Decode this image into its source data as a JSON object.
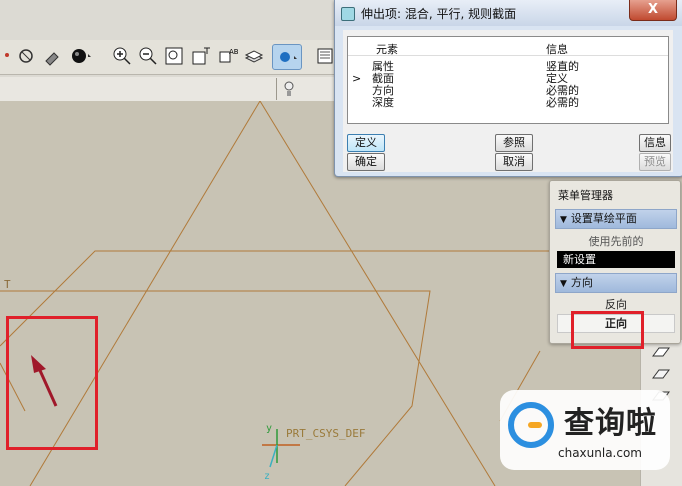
{
  "dialog": {
    "title": "伸出项: 混合, 平行, 规则截面",
    "close_symbol": "X",
    "col_element": "元素",
    "col_info": "信息",
    "current_marker": ">",
    "rows": [
      {
        "element": "属性",
        "info": "竖直的"
      },
      {
        "element": "截面",
        "info": "定义"
      },
      {
        "element": "方向",
        "info": "必需的"
      },
      {
        "element": "深度",
        "info": "必需的"
      }
    ],
    "buttons": {
      "define": "定义",
      "reference": "参照",
      "info": "信息",
      "ok": "确定",
      "cancel": "取消",
      "preview": "预览"
    }
  },
  "menu_manager": {
    "title": "菜单管理器",
    "sections": [
      {
        "header": "设置草绘平面",
        "items": [
          "使用先前的",
          "新设置"
        ]
      },
      {
        "header": "方向",
        "items": [
          "反向",
          "正向"
        ]
      }
    ]
  },
  "graphics": {
    "csys_label": "PRT_CSYS_DEF",
    "datum_label_fragment": "T",
    "axis_x": "x",
    "axis_y": "y",
    "axis_z": "z"
  },
  "watermark": {
    "brand": "查询啦",
    "url": "chaxunla.com"
  },
  "icons": {
    "toolbar": [
      "sketch-icon",
      "hammer-icon",
      "shading-icon",
      "zoom-in-icon",
      "zoom-out-icon",
      "refit-icon",
      "orient-icon",
      "layer-icon",
      "view-manager-icon",
      "saved-view-icon"
    ],
    "dialog_icon": "feature-icon"
  },
  "colors": {
    "highlight_box": "#e0202a",
    "sketch_lines": "#b07a3a",
    "dialog_title_bg": "#d9e4f2",
    "menu_header": "#a9c0e0"
  }
}
